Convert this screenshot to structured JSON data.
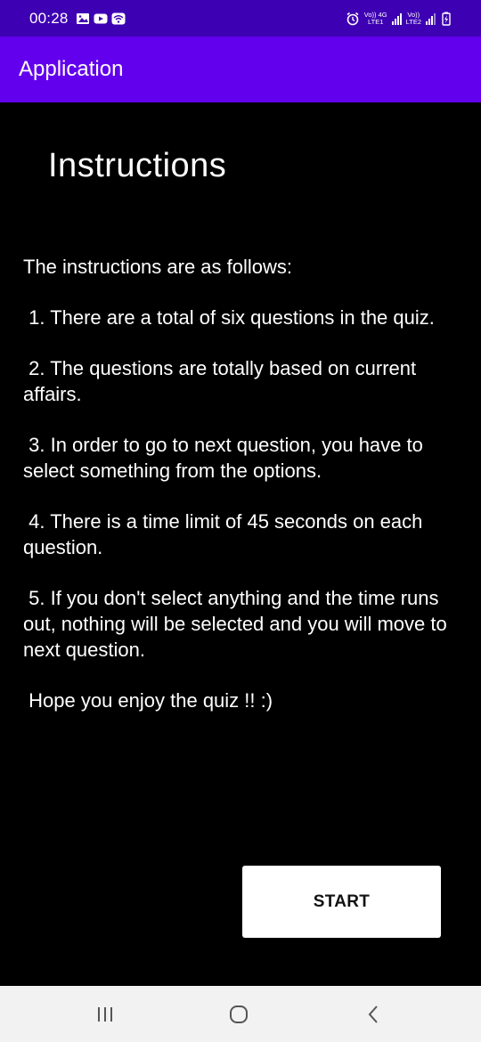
{
  "status_bar": {
    "time": "00:28",
    "sim1_label_top": "Vo)) 4G",
    "sim1_label_bottom": "LTE1",
    "sim2_label_top": "Vo))",
    "sim2_label_bottom": "LTE2",
    "left_icons": [
      "gallery-icon",
      "youtube-icon",
      "wifi-icon"
    ],
    "right_icons": [
      "alarm-icon",
      "signal-icon",
      "signal-icon",
      "battery-charging-icon"
    ]
  },
  "app_bar": {
    "title": "Application",
    "color": "#6200ee"
  },
  "content": {
    "heading": "Instructions",
    "intro": "The instructions are as follows:",
    "items": [
      " 1. There are a total of six questions in the quiz.",
      " 2. The questions are totally based on current affairs.",
      " 3. In order to go to next question, you have to select something from the options.",
      " 4. There is a time limit of 45 seconds on each question.",
      " 5. If you don't select anything and the time runs out, nothing will be selected and you will move to next question."
    ],
    "closing": " Hope you enjoy the quiz !! :)"
  },
  "start_button": {
    "label": "START"
  },
  "nav_bar": {
    "icons": [
      "recent-apps-icon",
      "home-icon",
      "back-icon"
    ]
  }
}
